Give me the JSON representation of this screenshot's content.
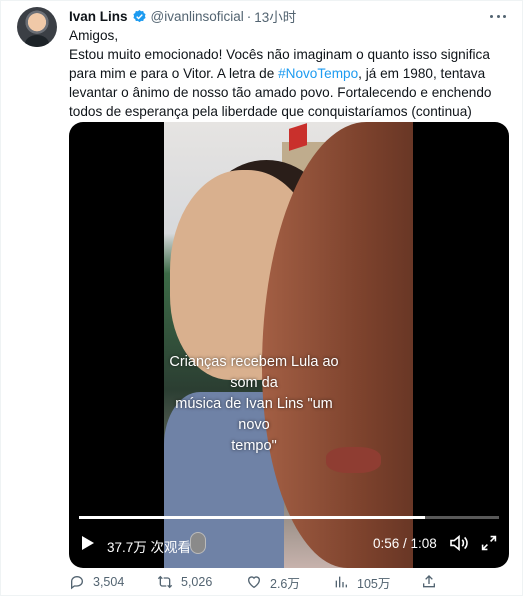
{
  "tweet": {
    "display_name": "Ivan Lins",
    "handle": "@ivanlinsoficial",
    "separator": "·",
    "time": "13小时",
    "text": {
      "line1": "Amigos,",
      "line2": "Estou muito emocionado! Vocês não imaginam o quanto isso significa",
      "line3": "para mim e para o Vitor. A letra de",
      "hashtag": "#NovoTempo",
      "line3_rest": ", já em 1980, tentava",
      "line4": "levantar o ânimo de nosso tão amado povo. Fortalecendo e enchendo",
      "line5": "todos de esperança pela liberdade que conquistaríamos (continua)"
    }
  },
  "video": {
    "caption_line1": "Crianças recebem Lula ao som da",
    "caption_line2": "música de Ivan Lins \"um novo",
    "caption_line3": "tempo\"",
    "views": "37.7万 次观看",
    "time_display": "0:56 / 1:08",
    "progress_fraction": 0.824
  },
  "actions": {
    "replies": "3,504",
    "retweets": "5,026",
    "likes": "2.6万",
    "views": "105万"
  },
  "colors": {
    "accent": "#1d9bf0",
    "secondary_text": "#536471"
  },
  "icons": [
    "verified-badge-icon",
    "more-icon",
    "play-icon",
    "volume-icon",
    "fullscreen-icon",
    "reply-icon",
    "retweet-icon",
    "like-icon",
    "analytics-icon",
    "share-icon"
  ]
}
